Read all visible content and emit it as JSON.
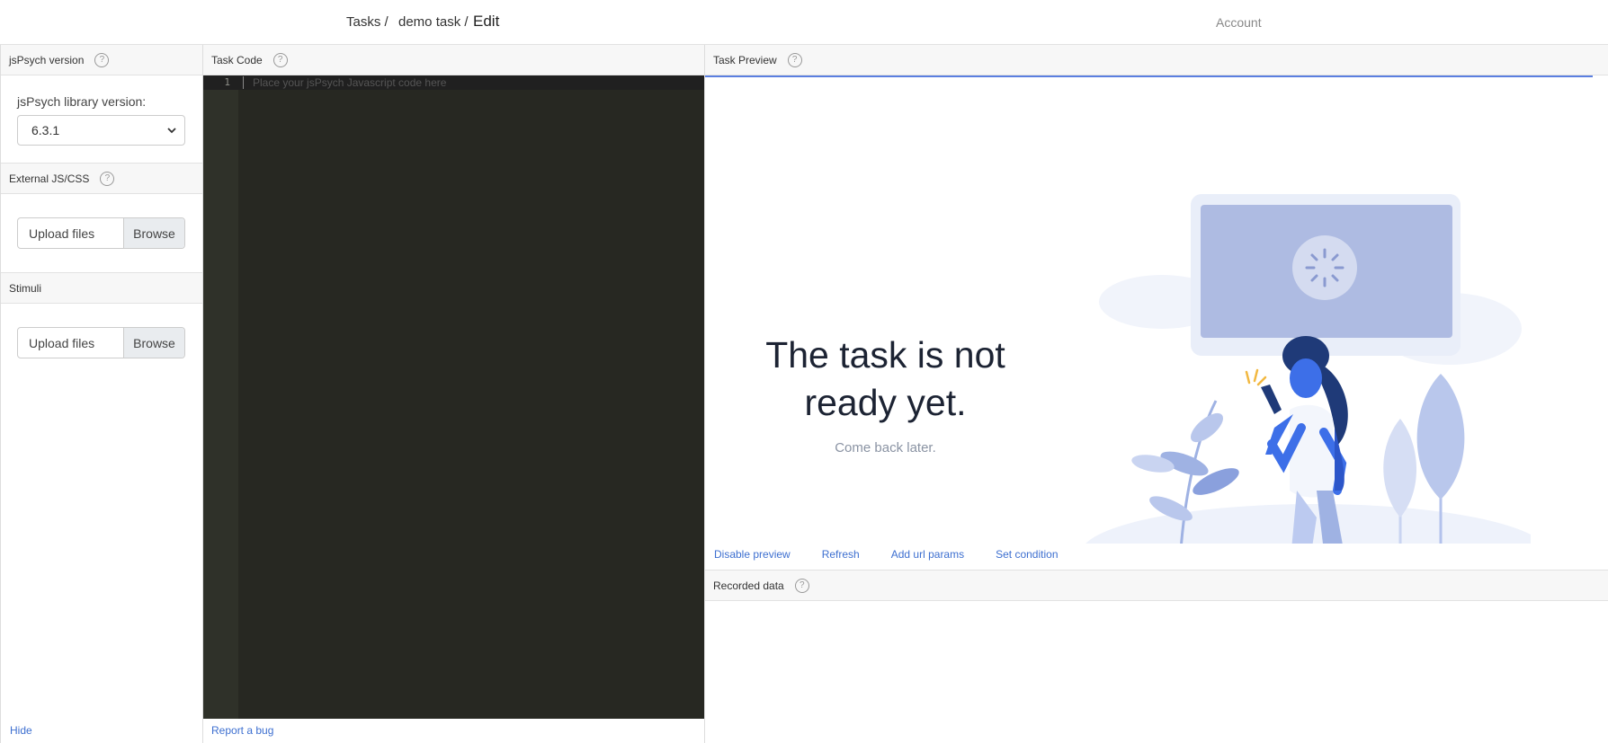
{
  "breadcrumb": {
    "tasks": "Tasks /",
    "task": "demo task /",
    "current": "Edit"
  },
  "account": "Account",
  "left": {
    "version_header": "jsPsych version",
    "library_label": "jsPsych library version:",
    "library_value": "6.3.1",
    "external_header": "External JS/CSS",
    "external_upload_placeholder": "Upload files",
    "external_browse": "Browse",
    "stimuli_header": "Stimuli",
    "stimuli_upload_placeholder": "Upload files",
    "stimuli_browse": "Browse",
    "hide": "Hide"
  },
  "code": {
    "header": "Task Code",
    "line_number": "1",
    "placeholder": "Place your jsPsych Javascript code here",
    "report_bug": "Report a bug"
  },
  "preview": {
    "header": "Task Preview",
    "title": "The task is not ready yet.",
    "subtitle": "Come back later.",
    "links": [
      "Disable preview",
      "Refresh",
      "Add url params",
      "Set condition"
    ]
  },
  "recorded": {
    "header": "Recorded data"
  },
  "icons": {
    "help": "?",
    "chevron": "⌄"
  },
  "colors": {
    "accent": "#5b7fe0",
    "link": "#3d6fd0",
    "editor_bg": "#272822"
  }
}
